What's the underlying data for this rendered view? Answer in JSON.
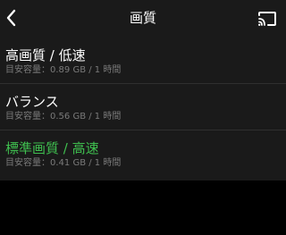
{
  "header": {
    "title": "画質"
  },
  "icons": {
    "back": "chevron-left-icon",
    "cast": "cast-icon"
  },
  "options": [
    {
      "label": "高画質 / 低速",
      "detail": "目安容量：0.89 GB / 1 時間"
    },
    {
      "label": "バランス",
      "detail": "目安容量：0.56 GB / 1 時間"
    },
    {
      "label": "標準画質 / 高速",
      "detail": "目安容量：0.41 GB / 1 時間"
    }
  ],
  "colors": {
    "background": "#000000",
    "surface": "#1a1a1a",
    "divider": "#2f2f2f",
    "secondary_text": "#7a7a7a",
    "selected_text": "#3fbf4f"
  }
}
